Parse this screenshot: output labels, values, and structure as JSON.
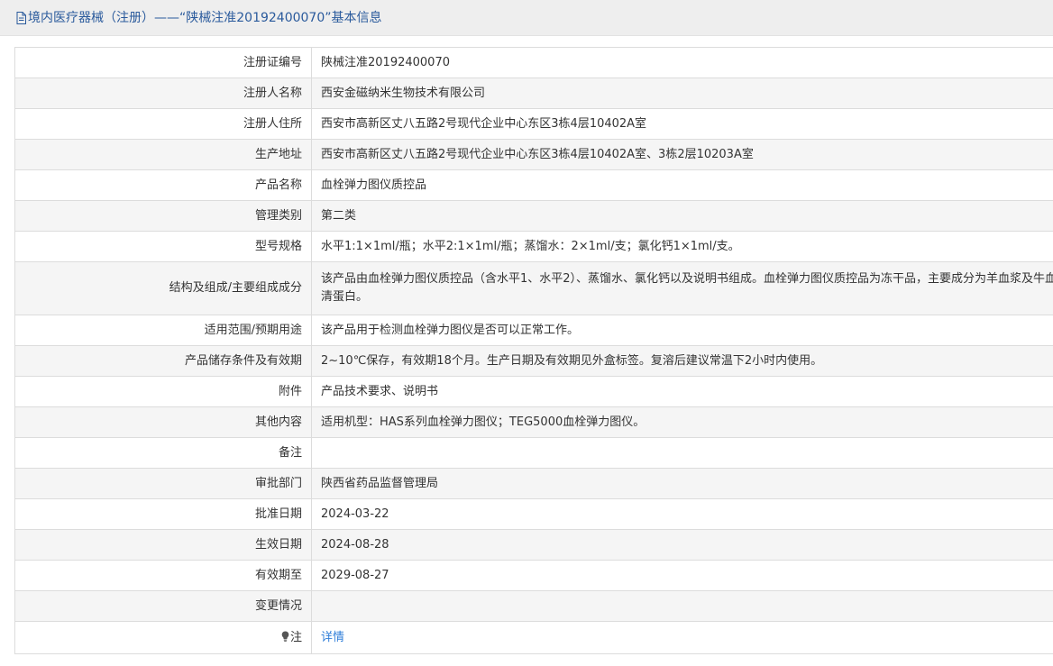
{
  "header": {
    "title": "境内医疗器械（注册）——“陕械注准20192400070”基本信息"
  },
  "rows": [
    {
      "label": "注册证编号",
      "value": "陕械注准20192400070"
    },
    {
      "label": "注册人名称",
      "value": "西安金磁纳米生物技术有限公司"
    },
    {
      "label": "注册人住所",
      "value": "西安市高新区丈八五路2号现代企业中心东区3栋4层10402A室"
    },
    {
      "label": "生产地址",
      "value": "西安市高新区丈八五路2号现代企业中心东区3栋4层10402A室、3栋2层10203A室"
    },
    {
      "label": "产品名称",
      "value": "血栓弹力图仪质控品"
    },
    {
      "label": "管理类别",
      "value": "第二类"
    },
    {
      "label": "型号规格",
      "value": "水平1:1×1ml/瓶；水平2:1×1ml/瓶；蒸馏水：2×1ml/支；氯化钙1×1ml/支。"
    },
    {
      "label": "结构及组成/主要组成成分",
      "value": "该产品由血栓弹力图仪质控品（含水平1、水平2）、蒸馏水、氯化钙以及说明书组成。血栓弹力图仪质控品为冻干品，主要成分为羊血浆及牛血清蛋白。"
    },
    {
      "label": "适用范围/预期用途",
      "value": "该产品用于检测血栓弹力图仪是否可以正常工作。"
    },
    {
      "label": "产品储存条件及有效期",
      "value": "2~10℃保存，有效期18个月。生产日期及有效期见外盒标签。复溶后建议常温下2小时内使用。"
    },
    {
      "label": "附件",
      "value": "产品技术要求、说明书"
    },
    {
      "label": "其他内容",
      "value": "适用机型：HAS系列血栓弹力图仪；TEG5000血栓弹力图仪。"
    },
    {
      "label": "备注",
      "value": ""
    },
    {
      "label": "审批部门",
      "value": "陕西省药品监督管理局"
    },
    {
      "label": "批准日期",
      "value": "2024-03-22"
    },
    {
      "label": "生效日期",
      "value": "2024-08-28"
    },
    {
      "label": "有效期至",
      "value": "2029-08-27"
    },
    {
      "label": "变更情况",
      "value": ""
    }
  ],
  "note": {
    "label": "注",
    "link_text": "详情",
    "icon": "lightbulb-icon"
  },
  "colors": {
    "title": "#2a5a9c",
    "link": "#2f7ed8",
    "row_alt": "#f5f5f5",
    "border": "#dcdcdc"
  }
}
